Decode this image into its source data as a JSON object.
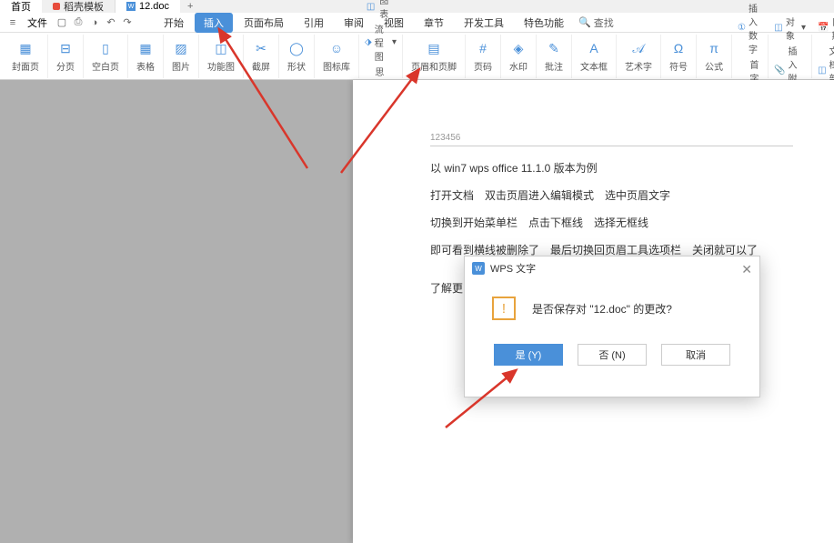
{
  "tabs": {
    "home": "首页",
    "template": "稻壳模板",
    "doc": "12.doc",
    "add": "+"
  },
  "file_menu": "文件",
  "menu": {
    "start": "开始",
    "insert": "插入",
    "layout": "页面布局",
    "reference": "引用",
    "review": "审阅",
    "view": "视图",
    "section": "章节",
    "dev": "开发工具",
    "special": "特色功能",
    "search": "查找"
  },
  "ribbon": {
    "cover": "封面页",
    "page_break": "分页",
    "blank": "空白页",
    "table": "表格",
    "picture": "图片",
    "feature": "功能图",
    "screenshot": "截屏",
    "shape": "形状",
    "icon_lib": "图标库",
    "chart": "图表",
    "flowchart": "流程图",
    "mindmap": "思维导图",
    "header_footer": "页眉和页脚",
    "page_number": "页码",
    "watermark": "水印",
    "comment": "批注",
    "textbox": "文本框",
    "wordart": "艺术字",
    "symbol": "符号",
    "equation": "公式",
    "insert_number": "插入数字",
    "object": "对象",
    "date": "日期",
    "dropcap": "首字下沉",
    "attachment": "插入附件",
    "docparts": "文档部件"
  },
  "doc_content": {
    "header_num": "123456",
    "line1": "以 win7 wps office 11.1.0 版本为例",
    "line2": "打开文档　双击页眉进入编辑模式　选中页眉文字",
    "line3": "切换到开始菜单栏　点击下框线　选择无框线",
    "line4": "即可看到横线被删除了　最后切换回页眉工具选项栏　关闭就可以了",
    "line5": "了解更"
  },
  "dialog": {
    "title": "WPS 文字",
    "message": "是否保存对 \"12.doc\" 的更改?",
    "yes": "是 (Y)",
    "no": "否 (N)",
    "cancel": "取消"
  }
}
